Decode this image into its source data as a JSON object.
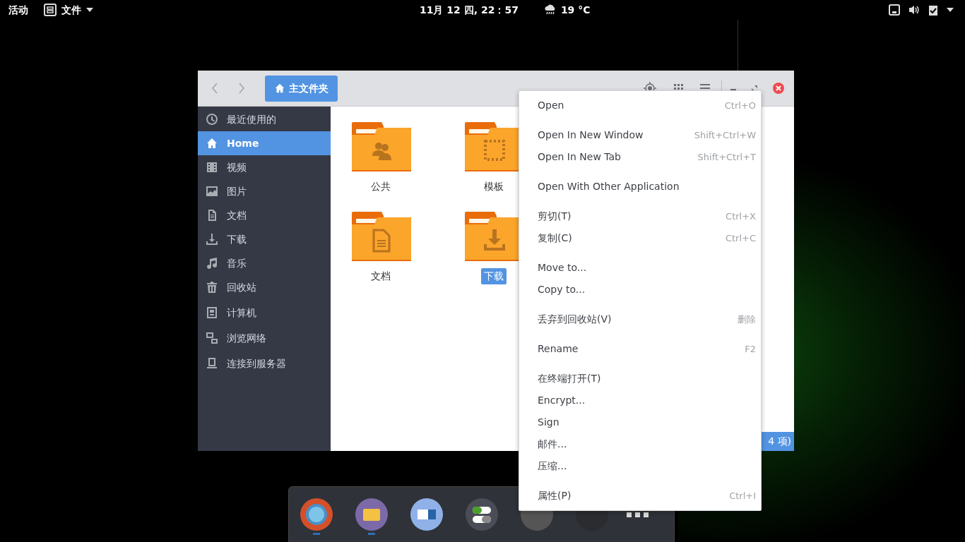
{
  "top_bar": {
    "activities": "活动",
    "app_menu": "文件",
    "clock": "11月 12 四, 22：57",
    "weather": "19 °C"
  },
  "window": {
    "path_button": "主文件夹",
    "status_fragment": "4 项)"
  },
  "sidebar": {
    "items": [
      {
        "label": "最近使用的",
        "kind": "recent",
        "selected": false
      },
      {
        "label": "Home",
        "kind": "home",
        "selected": true
      },
      {
        "label": "视频",
        "kind": "video",
        "selected": false
      },
      {
        "label": "图片",
        "kind": "picture",
        "selected": false
      },
      {
        "label": "文档",
        "kind": "document",
        "selected": false
      },
      {
        "label": "下载",
        "kind": "download",
        "selected": false
      },
      {
        "label": "音乐",
        "kind": "music",
        "selected": false
      },
      {
        "label": "回收站",
        "kind": "trash",
        "selected": false
      },
      {
        "label": "计算机",
        "kind": "computer",
        "selected": false
      },
      {
        "label": "浏览网络",
        "kind": "network",
        "selected": false
      },
      {
        "label": "连接到服务器",
        "kind": "server",
        "selected": false
      }
    ]
  },
  "folders": [
    {
      "label": "公共",
      "kind": "people",
      "selected": false
    },
    {
      "label": "模板",
      "kind": "template",
      "selected": false
    },
    {
      "label": "文档",
      "kind": "document",
      "selected": false
    },
    {
      "label": "下载",
      "kind": "download",
      "selected": true
    }
  ],
  "context_menu": {
    "groups": [
      [
        {
          "label": "Open",
          "shortcut": "Ctrl+O"
        }
      ],
      [
        {
          "label": "Open In New Window",
          "shortcut": "Shift+Ctrl+W"
        },
        {
          "label": "Open In New Tab",
          "shortcut": "Shift+Ctrl+T"
        }
      ],
      [
        {
          "label": "Open With Other Application"
        }
      ],
      [
        {
          "label": "剪切(T)",
          "shortcut": "Ctrl+X"
        },
        {
          "label": "复制(C)",
          "shortcut": "Ctrl+C"
        }
      ],
      [
        {
          "label": "Move to..."
        },
        {
          "label": "Copy to..."
        }
      ],
      [
        {
          "label": "丢弃到回收站(V)",
          "shortcut": "删除"
        }
      ],
      [
        {
          "label": "Rename",
          "shortcut": "F2"
        }
      ],
      [
        {
          "label": "在终端打开(T)"
        },
        {
          "label": "Encrypt..."
        },
        {
          "label": "Sign"
        },
        {
          "label": "邮件..."
        },
        {
          "label": "压缩..."
        }
      ],
      [
        {
          "label": "属性(P)",
          "shortcut": "Ctrl+I"
        }
      ]
    ]
  },
  "dock": {
    "apps": [
      {
        "kind": "browser",
        "running": true
      },
      {
        "kind": "files",
        "running": true
      },
      {
        "kind": "card",
        "running": false
      },
      {
        "kind": "toggles",
        "running": false
      },
      {
        "kind": "gray",
        "running": false
      },
      {
        "kind": "dark",
        "running": false
      }
    ]
  }
}
